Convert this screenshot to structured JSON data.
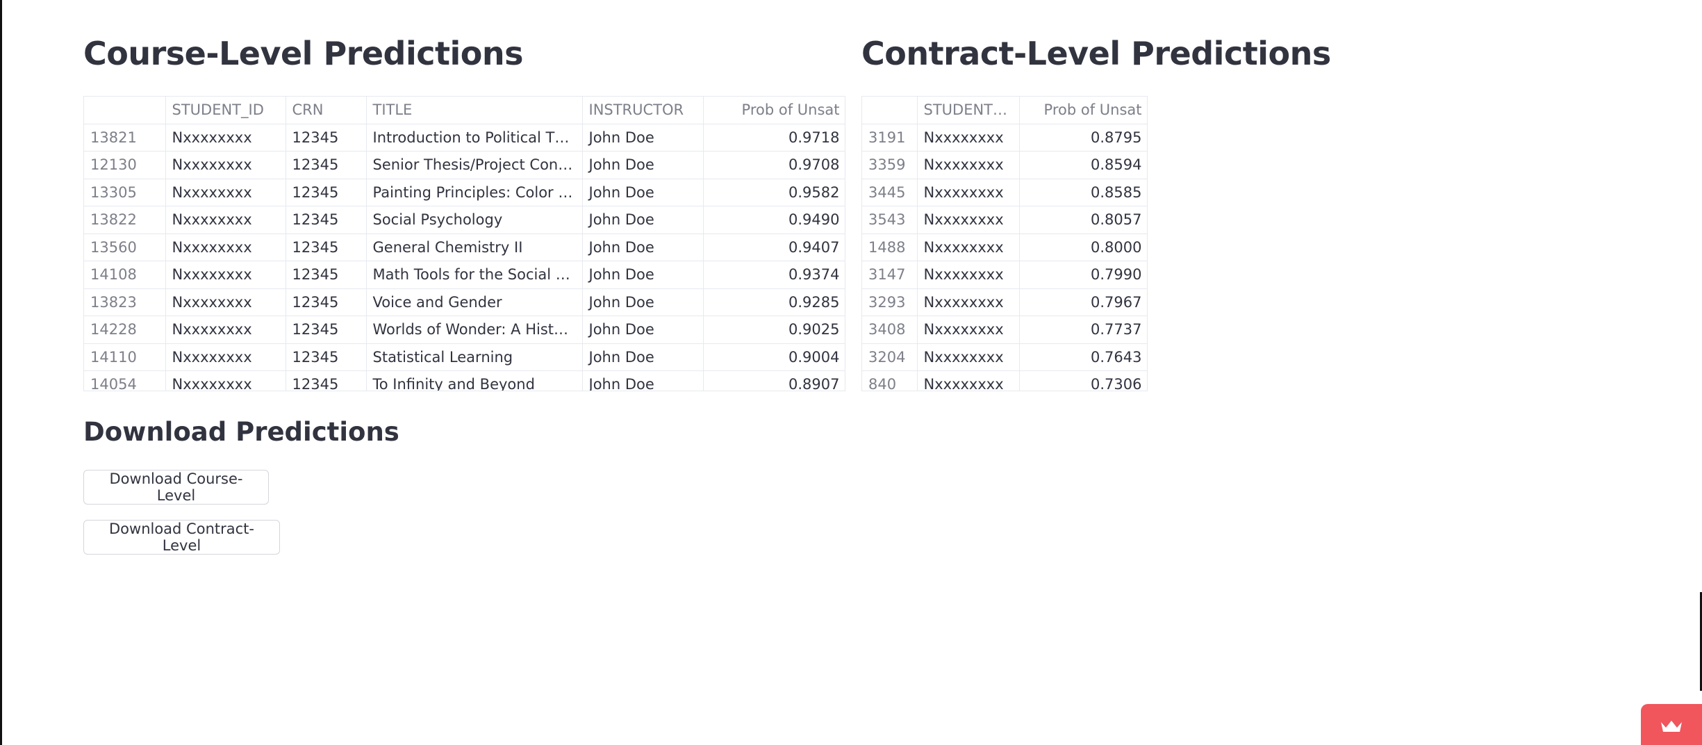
{
  "course": {
    "title": "Course-Level Predictions",
    "columns": [
      "",
      "STUDENT_ID",
      "CRN",
      "TITLE",
      "INSTRUCTOR",
      "Prob of Unsat"
    ],
    "rows": [
      [
        "13821",
        "Nxxxxxxxx",
        "12345",
        "Introduction to Political Th…",
        "John Doe",
        "0.9718"
      ],
      [
        "12130",
        "Nxxxxxxxx",
        "12345",
        "Senior Thesis/Project Conti…",
        "John Doe",
        "0.9708"
      ],
      [
        "13305",
        "Nxxxxxxxx",
        "12345",
        "Painting Principles: Color to…",
        "John Doe",
        "0.9582"
      ],
      [
        "13822",
        "Nxxxxxxxx",
        "12345",
        "Social Psychology",
        "John Doe",
        "0.9490"
      ],
      [
        "13560",
        "Nxxxxxxxx",
        "12345",
        "General Chemistry II",
        "John Doe",
        "0.9407"
      ],
      [
        "14108",
        "Nxxxxxxxx",
        "12345",
        "Math Tools for the Social Sc…",
        "John Doe",
        "0.9374"
      ],
      [
        "13823",
        "Nxxxxxxxx",
        "12345",
        "Voice and Gender",
        "John Doe",
        "0.9285"
      ],
      [
        "14228",
        "Nxxxxxxxx",
        "12345",
        "Worlds of Wonder: A Histor…",
        "John Doe",
        "0.9025"
      ],
      [
        "14110",
        "Nxxxxxxxx",
        "12345",
        "Statistical Learning",
        "John Doe",
        "0.9004"
      ],
      [
        "14054",
        "Nxxxxxxxx",
        "12345",
        "To Infinity and Beyond",
        "John Doe",
        "0.8907"
      ]
    ]
  },
  "contract": {
    "title": "Contract-Level Predictions",
    "columns": [
      "",
      "STUDENT_ID",
      "Prob of Unsat"
    ],
    "rows": [
      [
        "3191",
        "Nxxxxxxxx",
        "0.8795"
      ],
      [
        "3359",
        "Nxxxxxxxx",
        "0.8594"
      ],
      [
        "3445",
        "Nxxxxxxxx",
        "0.8585"
      ],
      [
        "3543",
        "Nxxxxxxxx",
        "0.8057"
      ],
      [
        "1488",
        "Nxxxxxxxx",
        "0.8000"
      ],
      [
        "3147",
        "Nxxxxxxxx",
        "0.7990"
      ],
      [
        "3293",
        "Nxxxxxxxx",
        "0.7967"
      ],
      [
        "3408",
        "Nxxxxxxxx",
        "0.7737"
      ],
      [
        "3204",
        "Nxxxxxxxx",
        "0.7643"
      ],
      [
        "840",
        "Nxxxxxxxx",
        "0.7306"
      ]
    ]
  },
  "download": {
    "title": "Download Predictions",
    "course_button": "Download Course-Level",
    "contract_button": "Download Contract-Level"
  },
  "badge": {
    "icon": "crown-icon",
    "color": "#f0565c"
  }
}
